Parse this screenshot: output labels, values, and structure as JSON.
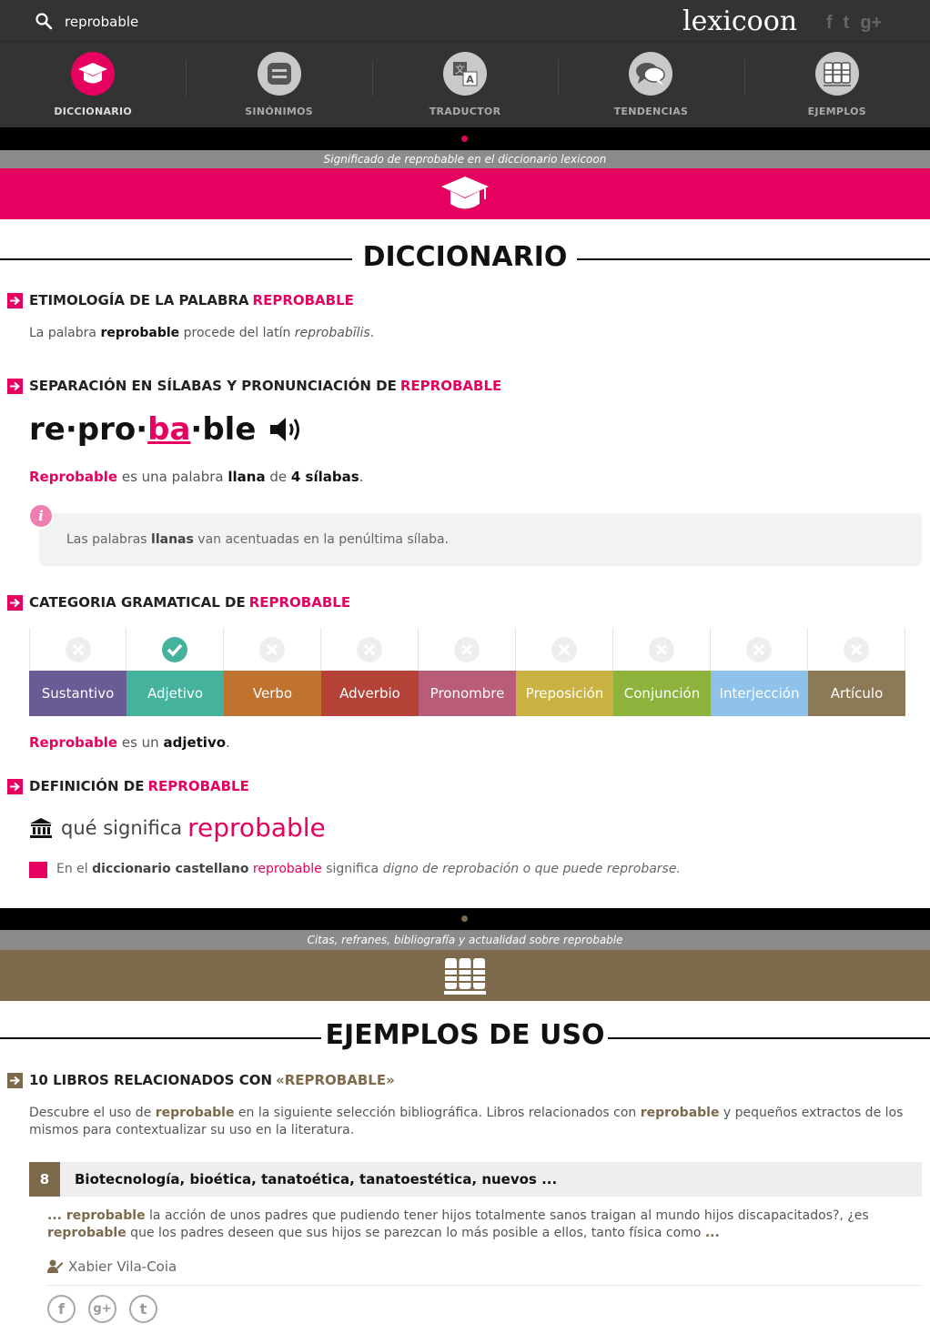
{
  "search": {
    "query": "reprobable"
  },
  "logo": "lexicoon",
  "social_top": [
    "f",
    "t",
    "g+"
  ],
  "nav": [
    {
      "label": "DICCIONARIO",
      "icon": "graduation-cap-icon",
      "active": true
    },
    {
      "label": "SINÓNIMOS",
      "icon": "synonyms-icon",
      "active": false
    },
    {
      "label": "TRADUCTOR",
      "icon": "translate-icon",
      "active": false
    },
    {
      "label": "TENDENCIAS",
      "icon": "chat-bubbles-icon",
      "active": false
    },
    {
      "label": "EJEMPLOS",
      "icon": "books-icon",
      "active": false
    }
  ],
  "colors": {
    "accent": "#e6005f",
    "brown": "#7d6a4d",
    "dark": "#333333"
  },
  "dict_band": {
    "subtitle": "Significado de reprobable en el diccionario lexicoon"
  },
  "dict_title": "DICCIONARIO",
  "etym": {
    "heading": "ETIMOLOGÍA DE LA PALABRA ",
    "word": "REPROBABLE",
    "t1": "La palabra ",
    "w": "reprobable",
    "t2": " procede del latín ",
    "latin": "reprobabĭlis",
    "t3": "."
  },
  "syll": {
    "heading": "SEPARACIÓN EN SÍLABAS Y PRONUNCIACIÓN DE ",
    "word": "REPROBABLE",
    "s1": "re·pro·",
    "stress": "ba",
    "s3": "·ble",
    "desc_word": "Reprobable",
    "desc1": " es una palabra ",
    "type": "llana",
    "desc2": " de ",
    "count": "4 sílabas",
    "desc3": ".",
    "info1": "Las palabras ",
    "info_b": "llanas",
    "info2": " van acentuadas en la penúltima sílaba."
  },
  "cat": {
    "heading": "CATEGORIA GRAMATICAL DE ",
    "word": "REPROBABLE",
    "items": [
      {
        "label": "Sustantivo",
        "color": "#6b5b95",
        "checked": false
      },
      {
        "label": "Adjetivo",
        "color": "#45b29d",
        "checked": true
      },
      {
        "label": "Verbo",
        "color": "#c0722f",
        "checked": false
      },
      {
        "label": "Adverbio",
        "color": "#b54236",
        "checked": false
      },
      {
        "label": "Pronombre",
        "color": "#b95c78",
        "checked": false
      },
      {
        "label": "Preposición",
        "color": "#c9b241",
        "checked": false
      },
      {
        "label": "Conjunción",
        "color": "#8db33c",
        "checked": false
      },
      {
        "label": "Interjección",
        "color": "#8ec2ea",
        "checked": false
      },
      {
        "label": "Artículo",
        "color": "#8c7a57",
        "checked": false
      }
    ],
    "desc_word": "Reprobable",
    "desc1": " es un ",
    "desc_b": "adjetivo",
    "desc2": "."
  },
  "def": {
    "heading": "DEFINICIÓN DE ",
    "word": "REPROBABLE",
    "q1": "qué significa ",
    "q_word": "reprobable",
    "t1": "En el ",
    "dict": "diccionario castellano",
    "t_word": " reprobable",
    "t2": " significa ",
    "meaning": "digno de reprobación o que puede reprobarse."
  },
  "ex_band": {
    "subtitle": "Citas, refranes, bibliografía y actualidad sobre reprobable"
  },
  "ex_title": "EJEMPLOS DE USO",
  "books": {
    "heading": "10 LIBROS RELACIONADOS CON ",
    "word": "«REPROBABLE»",
    "d1": "Descubre el uso de ",
    "dw1": "reprobable",
    "d2": " en la siguiente selección bibliográfica. Libros relacionados con ",
    "dw2": "reprobable",
    "d3": " y pequeños extractos de los mismos para contextualizar su uso en la literatura.",
    "item": {
      "num": "8",
      "title": "Biotecnología, bioética, tanatoética, tanatoestética, nuevos ...",
      "e0": "... ",
      "ew1": "reprobable",
      "e1": " la acción de unos padres que pudiendo tener hijos totalmente sanos traigan al mundo hijos discapacitados?, ¿es ",
      "ew2": "reprobable",
      "e2": " que los padres deseen que sus hijos se parezcan lo más posible a ellos, tanto física como ",
      "e3": "...",
      "author": "Xabier Vila-Coia"
    },
    "share": [
      "f",
      "g+",
      "t"
    ]
  }
}
